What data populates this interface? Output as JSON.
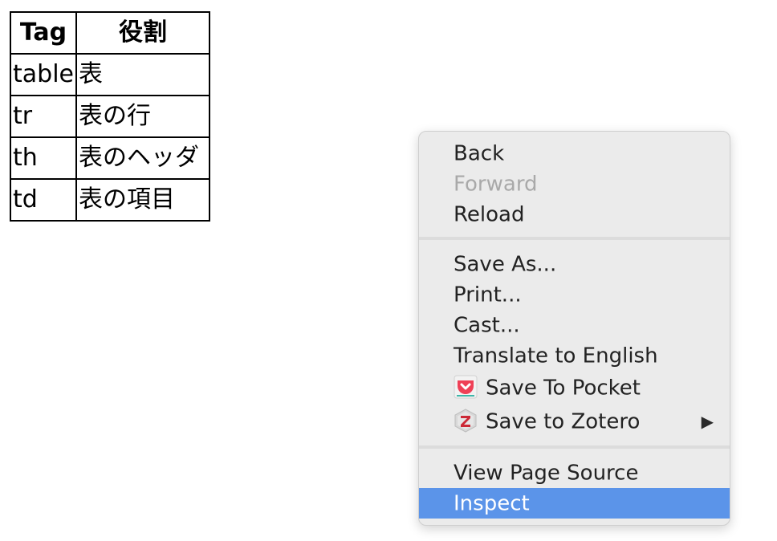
{
  "table": {
    "headers": [
      "Tag",
      "役割"
    ],
    "rows": [
      [
        "table",
        "表"
      ],
      [
        "tr",
        "表の行"
      ],
      [
        "th",
        "表のヘッダ"
      ],
      [
        "td",
        "表の項目"
      ]
    ]
  },
  "menu": {
    "back": "Back",
    "forward": "Forward",
    "reload": "Reload",
    "save_as": "Save As...",
    "print": "Print...",
    "cast": "Cast...",
    "translate": "Translate to English",
    "save_to_pocket": "Save To Pocket",
    "save_to_zotero": "Save to Zotero",
    "view_source": "View Page Source",
    "inspect": "Inspect",
    "submenu_arrow": "▶"
  },
  "icons": {
    "pocket": "pocket-icon",
    "zotero": "zotero-icon"
  },
  "colors": {
    "highlight": "#5b94e9",
    "disabled_text": "#a9a9a9",
    "menu_bg": "#ebebeb"
  }
}
